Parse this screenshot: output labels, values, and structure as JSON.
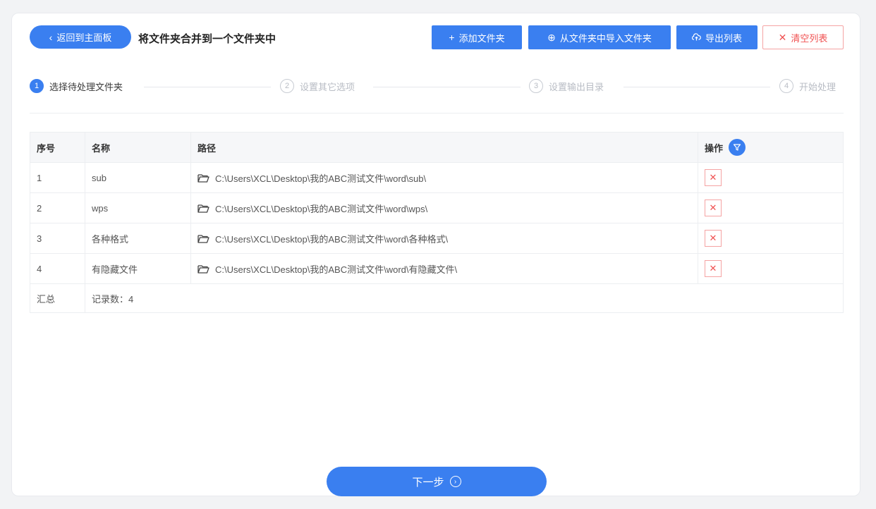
{
  "header": {
    "back_label": "返回到主面板",
    "title": "将文件夹合并到一个文件夹中"
  },
  "toolbar": {
    "add_folder": "添加文件夹",
    "import_from_folder": "从文件夹中导入文件夹",
    "export_list": "导出列表",
    "clear_list": "清空列表"
  },
  "steps": [
    {
      "num": "1",
      "label": "选择待处理文件夹"
    },
    {
      "num": "2",
      "label": "设置其它选项"
    },
    {
      "num": "3",
      "label": "设置输出目录"
    },
    {
      "num": "4",
      "label": "开始处理"
    }
  ],
  "table": {
    "columns": [
      "序号",
      "名称",
      "路径",
      "操作"
    ],
    "rows": [
      {
        "index": "1",
        "name": "sub",
        "path": "C:\\Users\\XCL\\Desktop\\我的ABC测试文件\\word\\sub\\"
      },
      {
        "index": "2",
        "name": "wps",
        "path": "C:\\Users\\XCL\\Desktop\\我的ABC测试文件\\word\\wps\\"
      },
      {
        "index": "3",
        "name": "各种格式",
        "path": "C:\\Users\\XCL\\Desktop\\我的ABC测试文件\\word\\各种格式\\"
      },
      {
        "index": "4",
        "name": "有隐藏文件",
        "path": "C:\\Users\\XCL\\Desktop\\我的ABC测试文件\\word\\有隐藏文件\\"
      }
    ],
    "summary_label": "汇总",
    "summary_value": "记录数：4"
  },
  "footer": {
    "next_label": "下一步"
  },
  "icons": {
    "back": "chevron-left-icon",
    "add": "plus-icon",
    "import": "plus-circle-icon",
    "export": "cloud-upload-icon",
    "clear": "close-icon",
    "filter": "filter-icon",
    "folder": "folder-icon",
    "delete": "close-icon",
    "next": "chevron-right-circle-icon"
  },
  "colors": {
    "primary": "#3a7ff0",
    "danger": "#f05252"
  }
}
